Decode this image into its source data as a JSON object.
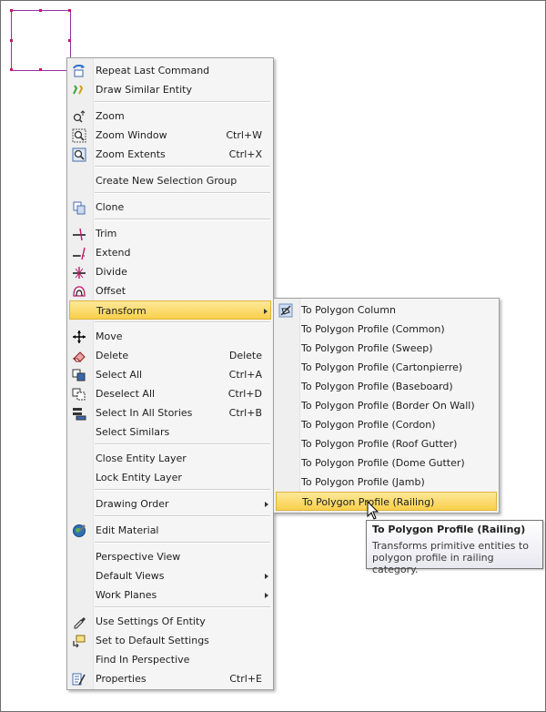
{
  "context_menu": {
    "items": [
      {
        "id": "repeat-last-command",
        "label": "Repeat Last Command",
        "shortcut": "",
        "icon": "repeat-command-icon"
      },
      {
        "id": "draw-similar-entity",
        "label": "Draw Similar Entity",
        "shortcut": "",
        "icon": "draw-similar-icon"
      },
      {
        "id": "zoom",
        "label": "Zoom",
        "shortcut": "",
        "icon": "zoom-icon"
      },
      {
        "id": "zoom-window",
        "label": "Zoom Window",
        "shortcut": "Ctrl+W",
        "icon": "zoom-window-icon"
      },
      {
        "id": "zoom-extents",
        "label": "Zoom Extents",
        "shortcut": "Ctrl+X",
        "icon": "zoom-extents-icon"
      },
      {
        "id": "create-new-selection-group",
        "label": "Create New Selection Group",
        "shortcut": "",
        "icon": ""
      },
      {
        "id": "clone",
        "label": "Clone",
        "shortcut": "",
        "icon": "clone-icon"
      },
      {
        "id": "trim",
        "label": "Trim",
        "shortcut": "",
        "icon": "trim-icon"
      },
      {
        "id": "extend",
        "label": "Extend",
        "shortcut": "",
        "icon": "extend-icon"
      },
      {
        "id": "divide",
        "label": "Divide",
        "shortcut": "",
        "icon": "divide-icon"
      },
      {
        "id": "offset",
        "label": "Offset",
        "shortcut": "",
        "icon": "offset-icon"
      },
      {
        "id": "transform",
        "label": "Transform",
        "shortcut": "",
        "icon": "",
        "submenu": true,
        "highlighted": true
      },
      {
        "id": "move",
        "label": "Move",
        "shortcut": "",
        "icon": "move-icon"
      },
      {
        "id": "delete",
        "label": "Delete",
        "shortcut": "Delete",
        "icon": "delete-eraser-icon"
      },
      {
        "id": "select-all",
        "label": "Select All",
        "shortcut": "Ctrl+A",
        "icon": "select-all-icon"
      },
      {
        "id": "deselect-all",
        "label": "Deselect All",
        "shortcut": "Ctrl+D",
        "icon": "deselect-all-icon"
      },
      {
        "id": "select-in-all-stories",
        "label": "Select In All Stories",
        "shortcut": "Ctrl+B",
        "icon": "select-stories-icon"
      },
      {
        "id": "select-similars",
        "label": "Select Similars",
        "shortcut": "",
        "icon": ""
      },
      {
        "id": "close-entity-layer",
        "label": "Close Entity Layer",
        "shortcut": "",
        "icon": ""
      },
      {
        "id": "lock-entity-layer",
        "label": "Lock Entity Layer",
        "shortcut": "",
        "icon": ""
      },
      {
        "id": "drawing-order",
        "label": "Drawing Order",
        "shortcut": "",
        "icon": "",
        "submenu": true
      },
      {
        "id": "edit-material",
        "label": "Edit Material",
        "shortcut": "",
        "icon": "material-globe-icon"
      },
      {
        "id": "perspective-view",
        "label": "Perspective View",
        "shortcut": "",
        "icon": ""
      },
      {
        "id": "default-views",
        "label": "Default Views",
        "shortcut": "",
        "icon": "",
        "submenu": true
      },
      {
        "id": "work-planes",
        "label": "Work Planes",
        "shortcut": "",
        "icon": "",
        "submenu": true
      },
      {
        "id": "use-settings-of-entity",
        "label": "Use Settings Of Entity",
        "shortcut": "",
        "icon": "eyedropper-icon"
      },
      {
        "id": "set-to-default-settings",
        "label": "Set to Default Settings",
        "shortcut": "",
        "icon": "default-settings-icon"
      },
      {
        "id": "find-in-perspective",
        "label": "Find In Perspective",
        "shortcut": "",
        "icon": ""
      },
      {
        "id": "properties",
        "label": "Properties",
        "shortcut": "Ctrl+E",
        "icon": "properties-icon"
      }
    ]
  },
  "transform_submenu": {
    "items": [
      {
        "id": "to-polygon-column",
        "label": "To Polygon Column",
        "icon": "polygon-column-icon"
      },
      {
        "id": "to-polygon-profile-common",
        "label": "To Polygon Profile (Common)"
      },
      {
        "id": "to-polygon-profile-sweep",
        "label": "To Polygon Profile (Sweep)"
      },
      {
        "id": "to-polygon-profile-cartonpierre",
        "label": "To Polygon Profile (Cartonpierre)"
      },
      {
        "id": "to-polygon-profile-baseboard",
        "label": "To Polygon Profile (Baseboard)"
      },
      {
        "id": "to-polygon-profile-border-on-wall",
        "label": "To Polygon Profile (Border On Wall)"
      },
      {
        "id": "to-polygon-profile-cordon",
        "label": "To Polygon Profile (Cordon)"
      },
      {
        "id": "to-polygon-profile-roof-gutter",
        "label": "To Polygon Profile (Roof Gutter)"
      },
      {
        "id": "to-polygon-profile-dome-gutter",
        "label": "To Polygon Profile (Dome Gutter)"
      },
      {
        "id": "to-polygon-profile-jamb",
        "label": "To Polygon Profile (Jamb)"
      },
      {
        "id": "to-polygon-profile-railing",
        "label": "To Polygon Profile (Railing)",
        "highlighted": true
      }
    ]
  },
  "tooltip": {
    "title": "To Polygon Profile (Railing)",
    "body": "Transforms primitive entities to polygon profile in railing category."
  },
  "colors": {
    "highlight": "#f8d04a",
    "entity_outline": "#9b2fa8",
    "grip": "#c0186a"
  }
}
